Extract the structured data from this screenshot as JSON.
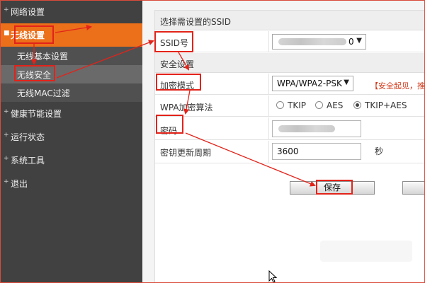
{
  "sidebar": {
    "items": [
      {
        "label": "网络设置"
      },
      {
        "label": "无线设置"
      },
      {
        "label": "无线基本设置"
      },
      {
        "label": "无线安全"
      },
      {
        "label": "无线MAC过滤"
      },
      {
        "label": "健康节能设置"
      },
      {
        "label": "运行状态"
      },
      {
        "label": "系统工具"
      },
      {
        "label": "退出"
      }
    ]
  },
  "section_ssid": {
    "title": "选择需设置的SSID",
    "ssid_label": "SSID号",
    "ssid_value_suffix": "0"
  },
  "section_security": {
    "title": "安全设置",
    "mode_label": "加密模式",
    "mode_value": "WPA/WPA2-PSK",
    "mode_warning": "【安全起见，推荐",
    "algo_label": "WPA加密算法",
    "algo_options": [
      "TKIP",
      "AES",
      "TKIP+AES"
    ],
    "algo_selected": "TKIP+AES",
    "password_label": "密码",
    "renew_label": "密钥更新周期",
    "renew_value": "3600",
    "renew_unit": "秒"
  },
  "buttons": {
    "save": "保存"
  },
  "colors": {
    "sidebar_bg": "#414141",
    "active_bg": "#ec6f1a",
    "annotation": "#e2231a",
    "warning_text": "#d23c1d"
  },
  "icons": [
    "chevron-down-icon",
    "mouse-cursor-icon"
  ]
}
